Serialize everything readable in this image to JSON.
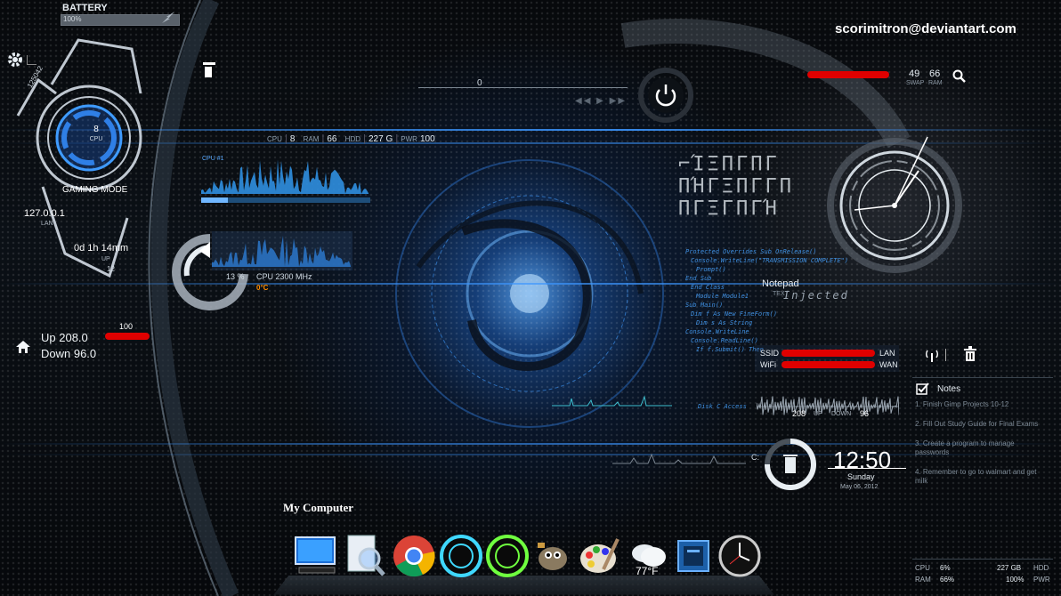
{
  "battery": {
    "label": "BATTERY",
    "percent": "100%",
    "level": 1.0
  },
  "watermark": "scorimitron@deviantart.com",
  "left_gauge": {
    "id": "125042",
    "cpu_value": "8",
    "cpu_label": "CPU",
    "mode": "GAMING MODE",
    "ip": "127.0.0.1",
    "ip_label": "LAN",
    "uptime": "0d 1h 14mm",
    "uptime_sub": "UP",
    "small_num": "12"
  },
  "network": {
    "up": "Up 208.0",
    "down": "Down 96.0",
    "bar_value": "100"
  },
  "top_stats": {
    "cpu_label": "CPU",
    "cpu": "8",
    "ram_label": "RAM",
    "ram": "66",
    "hdd_label": "HDD",
    "hdd": "227 G",
    "pwr_label": "PWR",
    "pwr": "100"
  },
  "media": {
    "position": "0"
  },
  "cpu_graph": {
    "title": "CPU #1"
  },
  "cpu_freq": {
    "percent": "13 %",
    "freq": "CPU 2300 MHz",
    "temp": "0°C"
  },
  "swap": {
    "swap": "49",
    "ram": "66",
    "swap_label": "SWAP",
    "ram_label": "RAM"
  },
  "code_text": [
    "Protected Overrides Sub OnRelease()",
    "Console.WriteLine(\"TRANSMISSION COMPLETE\")",
    "Prompt()",
    "End Sub",
    "End Class",
    "Module Module1",
    "Sub Main()",
    "Dim f As New FineForm()",
    "Dim s As String",
    "Console.WriteLine",
    "Console.ReadLine()",
    "If f.Submit() Then"
  ],
  "disk_label": "Disk C Access",
  "notepad": {
    "label": "Notepad",
    "sub": "TEXT",
    "injected": "Injected"
  },
  "wifi": {
    "ssid_label": "SSID",
    "wifi_label": "WiFi",
    "lan_label": "LAN",
    "wan_label": "WAN"
  },
  "traffic": {
    "up_val": "208",
    "up_label": "UP",
    "down_label": "DOWN",
    "down_val": "96"
  },
  "drive_label": "C:",
  "clock": {
    "time": "12:50",
    "day": "Sunday",
    "date": "May 06, 2012"
  },
  "notes": {
    "title": "Notes",
    "items": [
      "1. Finish Gimp Projects 10-12",
      "2. Fill Out Study Guide for Final Exams",
      "3. Create a program to manage passwords",
      "4. Remember to go to walmart and get milk"
    ]
  },
  "bottom_stats": {
    "cpu_label": "CPU",
    "cpu": "6%",
    "hdd": "227 GB",
    "hdd_label": "HDD",
    "ram_label": "RAM",
    "ram": "66%",
    "pwr": "100%",
    "pwr_label": "PWR"
  },
  "dock": {
    "label": "My Computer",
    "icons": [
      "computer-icon",
      "search-icon",
      "chrome-icon",
      "ring-blue-icon",
      "ring-green-icon",
      "gimp-icon",
      "paint-icon",
      "weather-icon",
      "folder-icon",
      "clock-icon"
    ],
    "weather_temp": "77°F"
  },
  "colors": {
    "accent": "#3f9bff",
    "red": "#e00000",
    "orange": "#ff8c00"
  }
}
